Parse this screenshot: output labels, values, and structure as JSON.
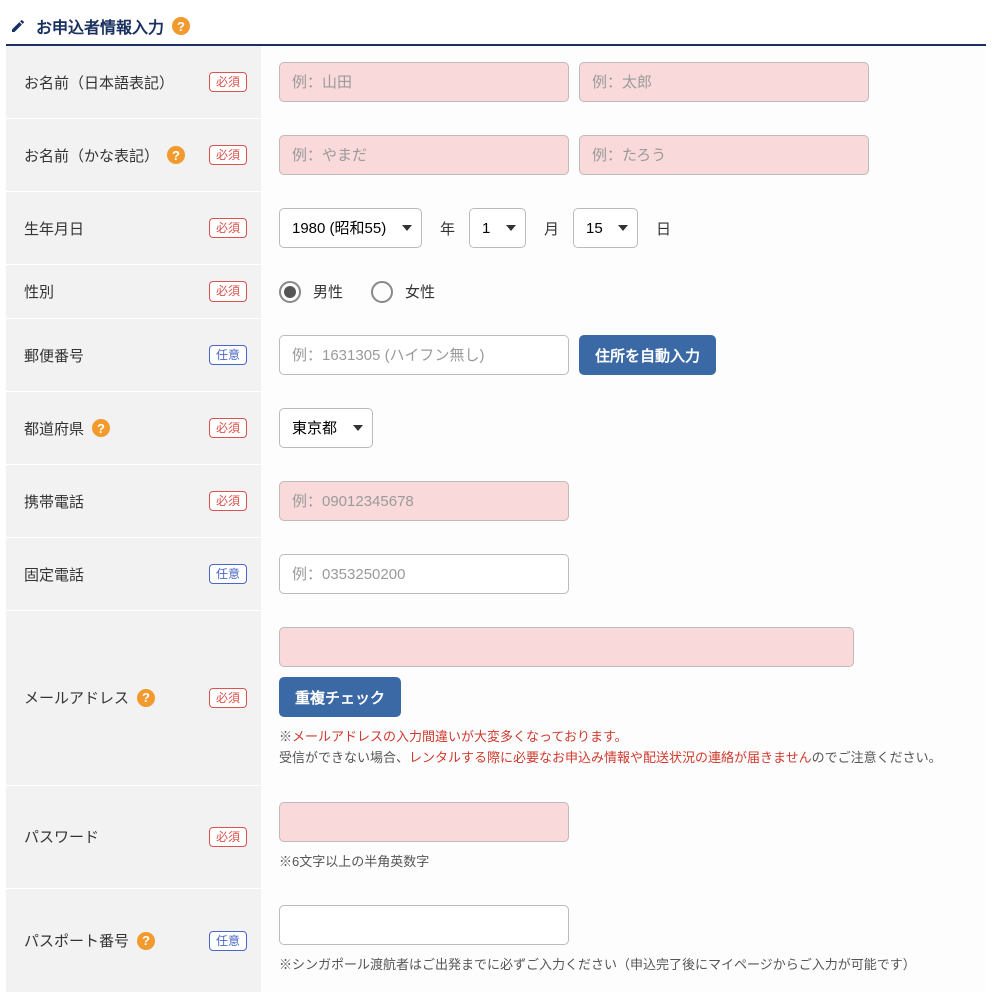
{
  "section": {
    "title": "お申込者情報入力"
  },
  "badges": {
    "required": "必須",
    "optional": "任意"
  },
  "rows": {
    "name_jp": {
      "label": "お名前（日本語表記）",
      "ph_last": "例：山田",
      "ph_first": "例：太郎"
    },
    "name_kana": {
      "label": "お名前（かな表記）",
      "ph_last": "例：やまだ",
      "ph_first": "例：たろう"
    },
    "birth": {
      "label": "生年月日",
      "year_value": "1980 (昭和55)",
      "month_value": "1",
      "day_value": "15",
      "year_unit": "年",
      "month_unit": "月",
      "day_unit": "日"
    },
    "gender": {
      "label": "性別",
      "male": "男性",
      "female": "女性"
    },
    "postal": {
      "label": "郵便番号",
      "ph": "例：1631305 (ハイフン無し)",
      "btn": "住所を自動入力"
    },
    "pref": {
      "label": "都道府県",
      "value": "東京都"
    },
    "mobile": {
      "label": "携帯電話",
      "ph": "例：09012345678"
    },
    "tel": {
      "label": "固定電話",
      "ph": "例：0353250200"
    },
    "email": {
      "label": "メールアドレス",
      "btn": "重複チェック",
      "note_prefix": "※",
      "note_red1": "メールアドレスの入力間違いが大変多くなっております。",
      "note_line2a": "受信ができない場合、",
      "note_red2": "レンタルする際に必要なお申込み情報や配送状況の連絡が届きません",
      "note_line2b": "のでご注意ください。"
    },
    "password": {
      "label": "パスワード",
      "note": "※6文字以上の半角英数字"
    },
    "passport": {
      "label": "パスポート番号",
      "note": "※シンガポール渡航者はご出発までに必ずご入力ください（申込完了後にマイページからご入力が可能です）"
    }
  }
}
